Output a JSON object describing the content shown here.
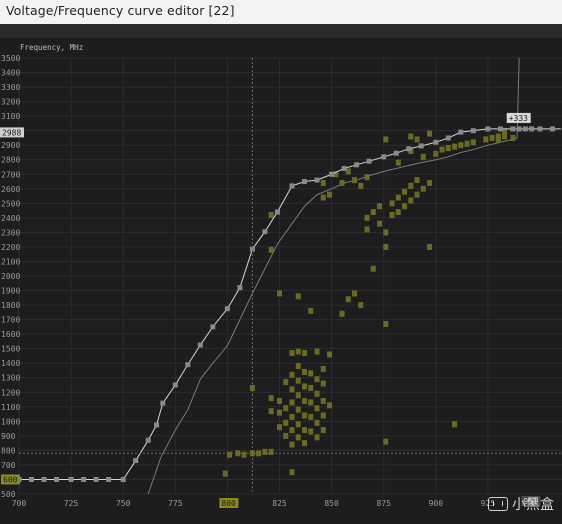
{
  "window": {
    "title": "Voltage/Frequency curve editor [22]"
  },
  "chart_data": {
    "type": "scatter",
    "ylabel": "Frequency, MHz",
    "xlim": [
      700,
      950
    ],
    "ylim": [
      500,
      3500
    ],
    "x_ticks": [
      "700",
      "725",
      "750",
      "775",
      "800",
      "825",
      "850",
      "875",
      "900",
      "925"
    ],
    "y_ticks": [
      "500",
      "600",
      "700",
      "800",
      "900",
      "1000",
      "1100",
      "1200",
      "1300",
      "1400",
      "1500",
      "1600",
      "1700",
      "1800",
      "1900",
      "2000",
      "2100",
      "2200",
      "2300",
      "2400",
      "2500",
      "2600",
      "2700",
      "2800",
      "2900",
      "3000",
      "3100",
      "3200",
      "3300",
      "3400",
      "3500"
    ],
    "selected_x_label": "800",
    "selected_y_label": "600",
    "current_y_label": "2988",
    "cursor_voltage_value": "812",
    "cursor_freq_value": "780",
    "bottom_right_label": "951",
    "hover_label": "+333",
    "colors": {
      "curve": "#d8d8d8",
      "points": "#8a8a8a",
      "default_curve": "#7a7a7a",
      "heat": "#6b6a1e",
      "highlight": "#8b8a1e",
      "grid": "#2c2c2e"
    },
    "series": [
      {
        "name": "",
        "x": [
          700,
          706,
          712,
          718,
          725,
          731,
          737,
          743,
          750,
          756,
          762,
          766,
          769,
          775,
          781,
          787,
          793,
          800,
          806,
          812,
          818,
          824,
          831,
          837,
          843,
          850,
          856,
          862,
          868,
          875,
          881,
          887,
          893,
          900,
          906,
          912,
          918,
          925,
          931,
          937,
          940,
          943,
          946,
          950,
          956,
          962,
          968,
          975
        ],
        "y": [
          600,
          600,
          600,
          600,
          600,
          600,
          600,
          600,
          600,
          730,
          870,
          975,
          1125,
          1250,
          1390,
          1525,
          1650,
          1775,
          1920,
          2185,
          2305,
          2440,
          2620,
          2650,
          2660,
          2700,
          2740,
          2765,
          2790,
          2820,
          2845,
          2875,
          2895,
          2920,
          2950,
          2990,
          3000,
          3012,
          3012,
          3012,
          3012,
          3012,
          3012,
          3012,
          3012,
          3012,
          3012,
          3012
        ]
      },
      {
        "name": "",
        "x": [
          762,
          768,
          775,
          781,
          787,
          793,
          800,
          806,
          812,
          818,
          824,
          831,
          837,
          843,
          850,
          856,
          862,
          868,
          875,
          881,
          887,
          893,
          900,
          906,
          912,
          918,
          925,
          931,
          937,
          939,
          940
        ],
        "y": [
          500,
          750,
          940,
          1080,
          1290,
          1400,
          1520,
          1700,
          1880,
          2050,
          2220,
          2360,
          2480,
          2560,
          2600,
          2640,
          2660,
          2690,
          2720,
          2740,
          2760,
          2780,
          2800,
          2820,
          2850,
          2870,
          2900,
          2920,
          2940,
          2950,
          3500
        ]
      }
    ],
    "heat_points": [
      {
        "x": 799,
        "y": 640
      },
      {
        "x": 801,
        "y": 770
      },
      {
        "x": 805,
        "y": 780
      },
      {
        "x": 808,
        "y": 770
      },
      {
        "x": 812,
        "y": 780
      },
      {
        "x": 815,
        "y": 780
      },
      {
        "x": 818,
        "y": 790
      },
      {
        "x": 821,
        "y": 790
      },
      {
        "x": 812,
        "y": 1230
      },
      {
        "x": 821,
        "y": 1070
      },
      {
        "x": 821,
        "y": 1160
      },
      {
        "x": 825,
        "y": 960
      },
      {
        "x": 825,
        "y": 1060
      },
      {
        "x": 825,
        "y": 1140
      },
      {
        "x": 828,
        "y": 900
      },
      {
        "x": 828,
        "y": 990
      },
      {
        "x": 828,
        "y": 1090
      },
      {
        "x": 828,
        "y": 1270
      },
      {
        "x": 831,
        "y": 840
      },
      {
        "x": 831,
        "y": 940
      },
      {
        "x": 831,
        "y": 1030
      },
      {
        "x": 831,
        "y": 1130
      },
      {
        "x": 831,
        "y": 1220
      },
      {
        "x": 831,
        "y": 1320
      },
      {
        "x": 831,
        "y": 1470
      },
      {
        "x": 831,
        "y": 650
      },
      {
        "x": 834,
        "y": 890
      },
      {
        "x": 834,
        "y": 980
      },
      {
        "x": 834,
        "y": 1080
      },
      {
        "x": 834,
        "y": 1180
      },
      {
        "x": 834,
        "y": 1280
      },
      {
        "x": 834,
        "y": 1380
      },
      {
        "x": 834,
        "y": 1480
      },
      {
        "x": 837,
        "y": 850
      },
      {
        "x": 837,
        "y": 940
      },
      {
        "x": 837,
        "y": 1040
      },
      {
        "x": 837,
        "y": 1140
      },
      {
        "x": 837,
        "y": 1240
      },
      {
        "x": 837,
        "y": 1340
      },
      {
        "x": 837,
        "y": 1470
      },
      {
        "x": 840,
        "y": 930
      },
      {
        "x": 840,
        "y": 1030
      },
      {
        "x": 840,
        "y": 1130
      },
      {
        "x": 840,
        "y": 1230
      },
      {
        "x": 840,
        "y": 1330
      },
      {
        "x": 843,
        "y": 890
      },
      {
        "x": 843,
        "y": 990
      },
      {
        "x": 843,
        "y": 1090
      },
      {
        "x": 843,
        "y": 1190
      },
      {
        "x": 843,
        "y": 1290
      },
      {
        "x": 843,
        "y": 1480
      },
      {
        "x": 846,
        "y": 940
      },
      {
        "x": 846,
        "y": 1040
      },
      {
        "x": 846,
        "y": 1140
      },
      {
        "x": 846,
        "y": 1260
      },
      {
        "x": 846,
        "y": 1360
      },
      {
        "x": 849,
        "y": 1110
      },
      {
        "x": 849,
        "y": 1460
      },
      {
        "x": 821,
        "y": 2420
      },
      {
        "x": 821,
        "y": 2180
      },
      {
        "x": 825,
        "y": 1880
      },
      {
        "x": 834,
        "y": 1860
      },
      {
        "x": 840,
        "y": 1760
      },
      {
        "x": 846,
        "y": 2640
      },
      {
        "x": 846,
        "y": 2540
      },
      {
        "x": 849,
        "y": 2560
      },
      {
        "x": 852,
        "y": 2700
      },
      {
        "x": 855,
        "y": 2640
      },
      {
        "x": 858,
        "y": 2720
      },
      {
        "x": 861,
        "y": 2660
      },
      {
        "x": 864,
        "y": 2620
      },
      {
        "x": 867,
        "y": 2680
      },
      {
        "x": 855,
        "y": 1740
      },
      {
        "x": 858,
        "y": 1840
      },
      {
        "x": 861,
        "y": 1880
      },
      {
        "x": 864,
        "y": 1800
      },
      {
        "x": 870,
        "y": 2050
      },
      {
        "x": 867,
        "y": 2320
      },
      {
        "x": 867,
        "y": 2400
      },
      {
        "x": 870,
        "y": 2440
      },
      {
        "x": 873,
        "y": 2360
      },
      {
        "x": 873,
        "y": 2480
      },
      {
        "x": 876,
        "y": 2300
      },
      {
        "x": 876,
        "y": 2200
      },
      {
        "x": 879,
        "y": 2500
      },
      {
        "x": 879,
        "y": 2420
      },
      {
        "x": 882,
        "y": 2540
      },
      {
        "x": 882,
        "y": 2440
      },
      {
        "x": 885,
        "y": 2580
      },
      {
        "x": 885,
        "y": 2480
      },
      {
        "x": 888,
        "y": 2620
      },
      {
        "x": 888,
        "y": 2520
      },
      {
        "x": 891,
        "y": 2660
      },
      {
        "x": 891,
        "y": 2560
      },
      {
        "x": 894,
        "y": 2600
      },
      {
        "x": 897,
        "y": 2640
      },
      {
        "x": 876,
        "y": 2940
      },
      {
        "x": 882,
        "y": 2780
      },
      {
        "x": 888,
        "y": 2860
      },
      {
        "x": 894,
        "y": 2820
      },
      {
        "x": 900,
        "y": 2840
      },
      {
        "x": 903,
        "y": 2870
      },
      {
        "x": 906,
        "y": 2880
      },
      {
        "x": 909,
        "y": 2890
      },
      {
        "x": 912,
        "y": 2900
      },
      {
        "x": 915,
        "y": 2910
      },
      {
        "x": 918,
        "y": 2920
      },
      {
        "x": 924,
        "y": 2940
      },
      {
        "x": 927,
        "y": 2950
      },
      {
        "x": 930,
        "y": 2960
      },
      {
        "x": 933,
        "y": 2960
      },
      {
        "x": 888,
        "y": 2960
      },
      {
        "x": 891,
        "y": 2940
      },
      {
        "x": 897,
        "y": 2980
      },
      {
        "x": 930,
        "y": 2940
      },
      {
        "x": 937,
        "y": 2950
      },
      {
        "x": 933,
        "y": 2990
      },
      {
        "x": 876,
        "y": 1670
      },
      {
        "x": 897,
        "y": 2200
      },
      {
        "x": 876,
        "y": 860
      },
      {
        "x": 909,
        "y": 980
      }
    ]
  }
}
